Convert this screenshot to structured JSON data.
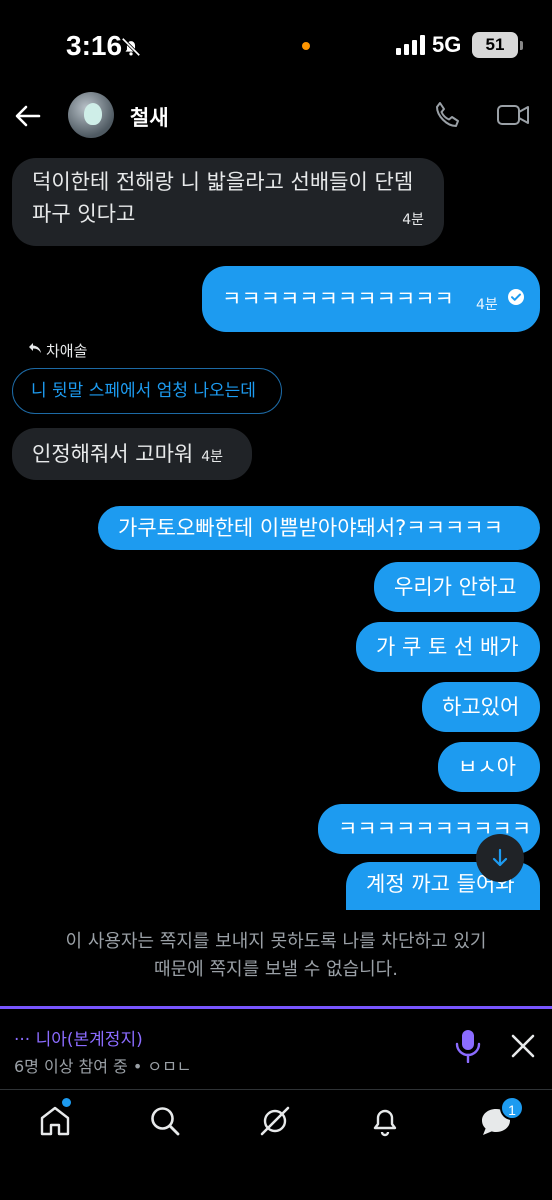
{
  "status_bar": {
    "time": "3:16",
    "network": "5G",
    "battery": "51"
  },
  "header": {
    "contact_name": "철새"
  },
  "messages": [
    {
      "direction": "in",
      "text_line1": "덕이한테 전해랑 니 밟을라고 선배들이 단뎀",
      "text_line2": "파구 잇다고",
      "time": "4분"
    },
    {
      "direction": "out",
      "text": "ㅋㅋㅋㅋㅋㅋㅋㅋㅋㅋㅋㅋ",
      "time": "4분",
      "read": true
    },
    {
      "direction": "in",
      "reply_to_name": "차애솔",
      "quoted_text": "니 뒷말 스페에서 엄청 나오는데",
      "text": "인정해줘서 고마워",
      "time": "4분"
    },
    {
      "direction": "out",
      "text": "가쿠토오빠한테 이쁨받아야돼서?ㅋㅋㅋㅋㅋ"
    },
    {
      "direction": "out",
      "text": "우리가 안하고"
    },
    {
      "direction": "out",
      "text": "가 쿠 토 선 배가"
    },
    {
      "direction": "out",
      "text": "하고있어"
    },
    {
      "direction": "out",
      "text": "ㅂㅅ아"
    },
    {
      "direction": "out",
      "text": "ㅋㅋㅋㅋㅋㅋㅋㅋㅋㅋ"
    },
    {
      "direction": "out",
      "text": "계정 까고 들어와"
    }
  ],
  "blocked_notice": {
    "line1": "이 사용자는 쪽지를 보내지 못하도록 나를 차단하고 있기",
    "line2": "때문에 쪽지를 보낼 수 없습니다."
  },
  "space": {
    "title": "··· 니아(본계정지)",
    "subtitle": "6명 이상 참여 중 • ㅇㅁㄴ"
  },
  "tab_bar": {
    "messages_badge": "1"
  },
  "colors": {
    "accent": "#1d9bf0",
    "space_accent": "#7856ff",
    "incoming_bubble": "#202327"
  }
}
